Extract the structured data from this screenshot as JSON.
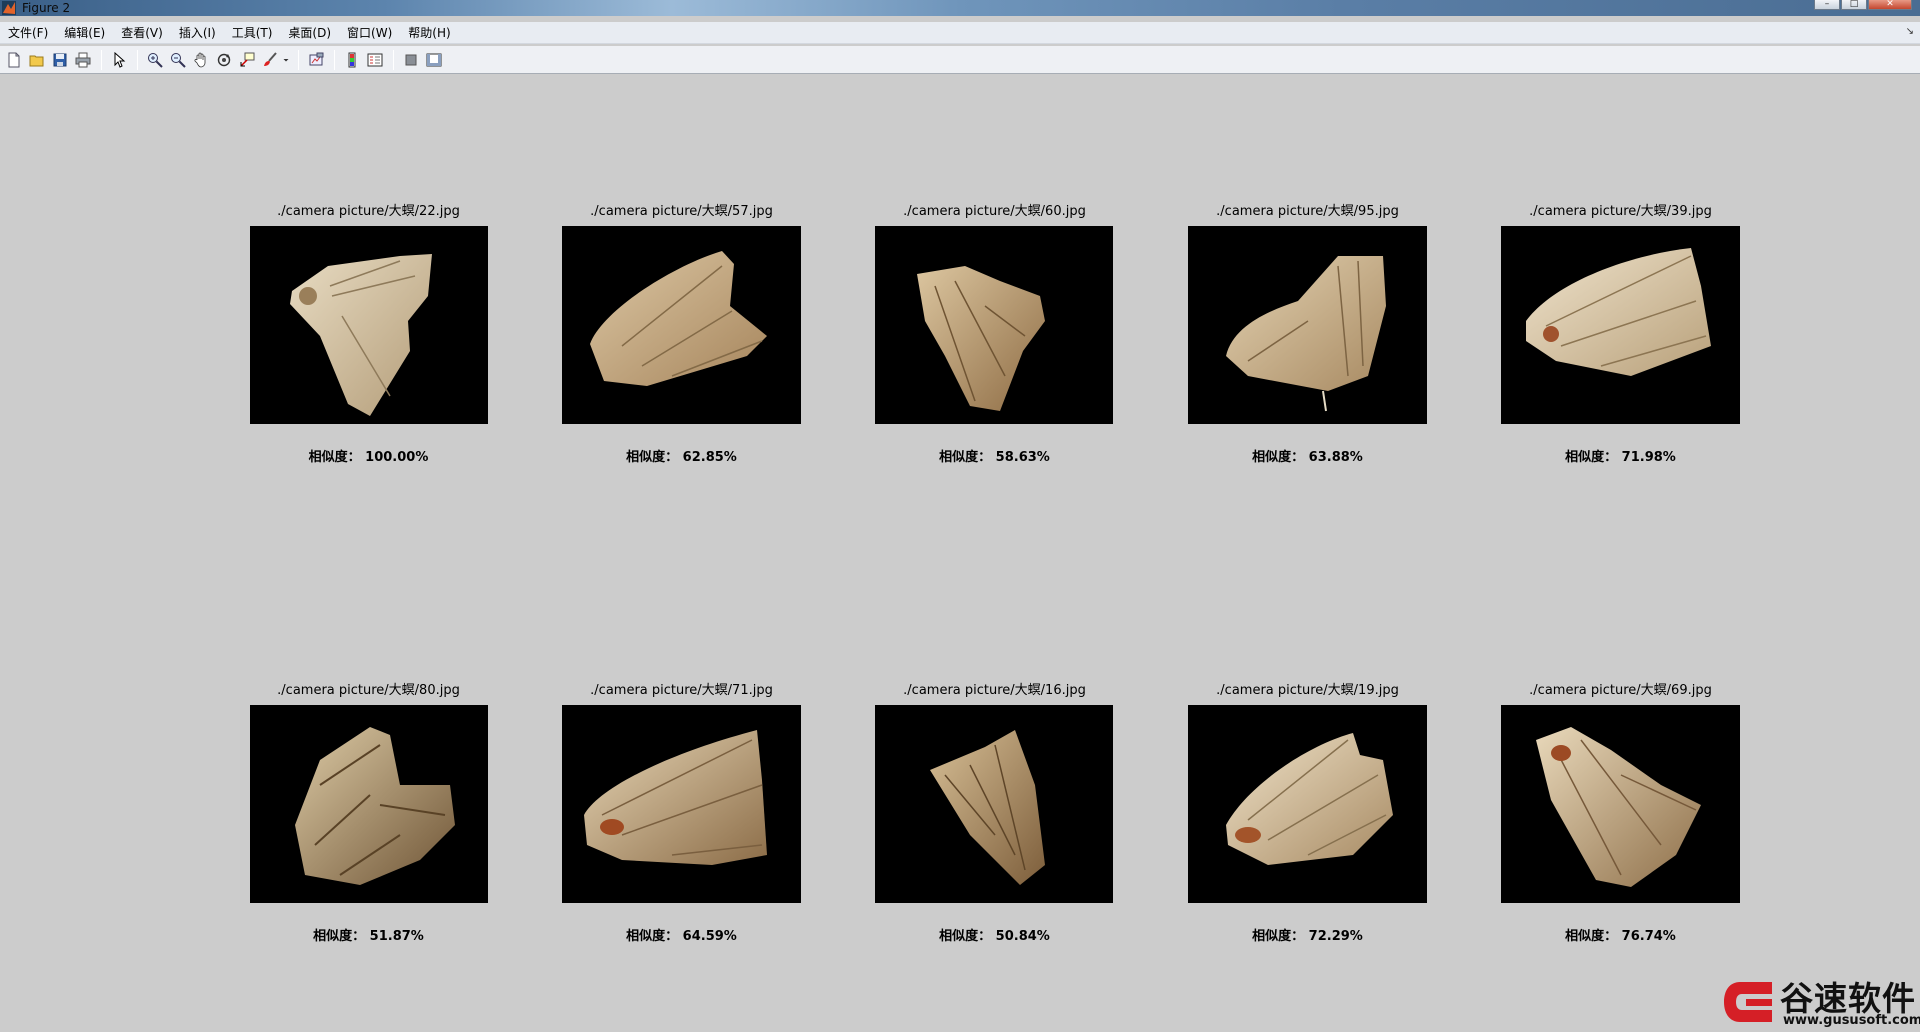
{
  "window": {
    "title": "Figure 2"
  },
  "menu": [
    "文件(F)",
    "编辑(E)",
    "查看(V)",
    "插入(I)",
    "工具(T)",
    "桌面(D)",
    "窗口(W)",
    "帮助(H)"
  ],
  "toolbar": [
    "new-figure",
    "open-file",
    "save",
    "print",
    "edit-plot",
    "zoom-in",
    "zoom-out",
    "pan",
    "rotate-3d",
    "data-cursor",
    "brush",
    "brush-dropdown",
    "link-plot",
    "insert-colorbar",
    "insert-legend",
    "hide-plot-tools",
    "show-plot-tools"
  ],
  "panels": [
    {
      "caption": "./camera picture/大螟/22.jpg",
      "similarity": "相似度： 100.00%"
    },
    {
      "caption": "./camera picture/大螟/57.jpg",
      "similarity": "相似度： 62.85%"
    },
    {
      "caption": "./camera picture/大螟/60.jpg",
      "similarity": "相似度： 58.63%"
    },
    {
      "caption": "./camera picture/大螟/95.jpg",
      "similarity": "相似度： 63.88%"
    },
    {
      "caption": "./camera picture/大螟/39.jpg",
      "similarity": "相似度： 71.98%"
    },
    {
      "caption": "./camera picture/大螟/80.jpg",
      "similarity": "相似度： 51.87%"
    },
    {
      "caption": "./camera picture/大螟/71.jpg",
      "similarity": "相似度： 64.59%"
    },
    {
      "caption": "./camera picture/大螟/16.jpg",
      "similarity": "相似度： 50.84%"
    },
    {
      "caption": "./camera picture/大螟/19.jpg",
      "similarity": "相似度： 72.29%"
    },
    {
      "caption": "./camera picture/大螟/69.jpg",
      "similarity": "相似度： 76.74%"
    }
  ],
  "watermark": {
    "name": "谷速软件",
    "url": "www.gususoft.com"
  }
}
